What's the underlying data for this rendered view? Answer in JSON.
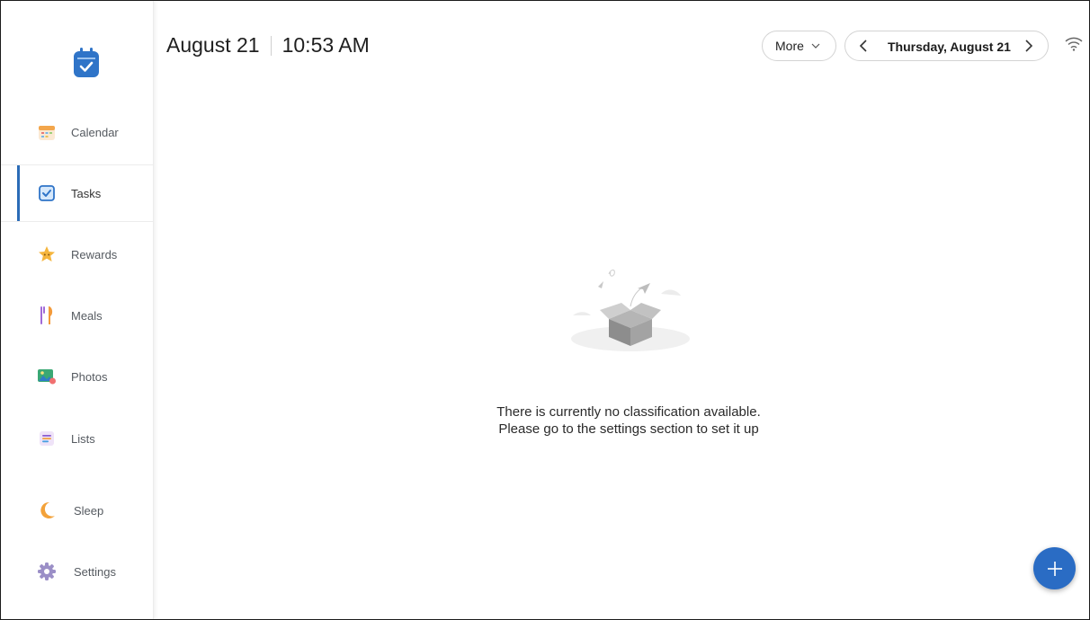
{
  "header": {
    "date": "August 21",
    "time": "10:53 AM",
    "more_label": "More",
    "current_day_label": "Thursday, August 21"
  },
  "sidebar": {
    "items": [
      {
        "label": "Calendar",
        "icon": "calendar-icon"
      },
      {
        "label": "Tasks",
        "icon": "tasks-checkbox-icon"
      },
      {
        "label": "Rewards",
        "icon": "star-icon"
      },
      {
        "label": "Meals",
        "icon": "fork-knife-icon"
      },
      {
        "label": "Photos",
        "icon": "photos-icon"
      },
      {
        "label": "Lists",
        "icon": "list-icon"
      },
      {
        "label": "Sleep",
        "icon": "moon-icon"
      },
      {
        "label": "Settings",
        "icon": "gear-icon"
      }
    ],
    "active": "Tasks"
  },
  "empty_state": {
    "line1": "There is currently no classification available.",
    "line2": "Please go to the settings section to set it up"
  },
  "colors": {
    "accent": "#2b6cb7",
    "fab": "#2a6cc4"
  }
}
